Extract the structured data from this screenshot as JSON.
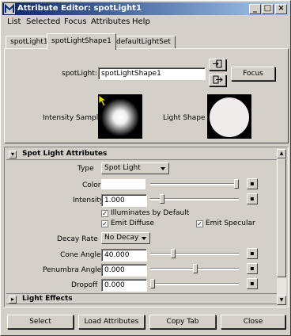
{
  "window": {
    "title": "Attribute Editor: spotLight1"
  },
  "menu": [
    {
      "label": "List"
    },
    {
      "label": "Selected"
    },
    {
      "label": "Focus"
    },
    {
      "label": "Attributes"
    },
    {
      "label": "Help"
    }
  ],
  "tabs": [
    {
      "label": "spotLight1"
    },
    {
      "label": "spotLightShape1"
    },
    {
      "label": "defaultLightSet"
    }
  ],
  "header": {
    "node_label": "spotLight:",
    "node_value": "spotLightShape1",
    "focus_label": "Focus",
    "intensity_sample_label": "Intensity Sample",
    "light_shape_label": "Light Shape"
  },
  "sections": {
    "spot": {
      "title": "Spot Light Attributes"
    },
    "effects": {
      "title": "Light Effects"
    }
  },
  "attributes": {
    "type_label": "Type",
    "type_value": "Spot Light",
    "color_label": "Color",
    "intensity_label": "Intensity",
    "intensity_value": "1.000",
    "illuminates_label": "Illuminates by Default",
    "emit_diffuse_label": "Emit Diffuse",
    "emit_specular_label": "Emit Specular",
    "decay_label": "Decay Rate",
    "decay_value": "No Decay",
    "cone_label": "Cone Angle",
    "cone_value": "40.000",
    "penumbra_label": "Penumbra Angle",
    "penumbra_value": "0.000",
    "dropoff_label": "Dropoff",
    "dropoff_value": "0.000",
    "checked_glyph": "✓"
  },
  "buttons": {
    "select": "Select",
    "load": "Load Attributes",
    "copy": "Copy Tab",
    "close": "Close"
  },
  "colors": {
    "title_gradient_start": "#0a246a",
    "title_gradient_end": "#a6caf0",
    "chrome": "#d4d0c8"
  }
}
